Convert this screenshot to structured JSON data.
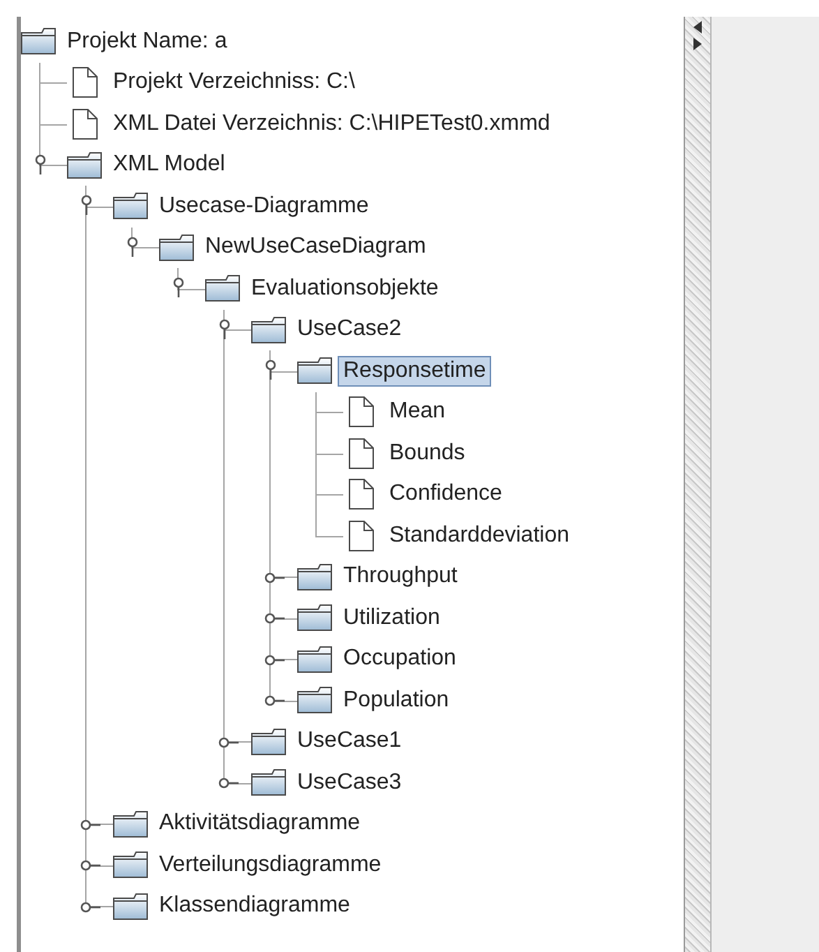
{
  "tree": {
    "label": "Projekt Name: a",
    "kind": "folder",
    "selected": false,
    "children": [
      {
        "label": "Projekt Verzeichniss: C:\\",
        "kind": "file",
        "selected": false
      },
      {
        "label": "XML Datei Verzeichnis: C:\\HIPETest0.xmmd",
        "kind": "file",
        "selected": false
      },
      {
        "label": "XML Model",
        "kind": "folder",
        "expanded": true,
        "selected": false,
        "children": [
          {
            "label": "Usecase-Diagramme",
            "kind": "folder",
            "expanded": true,
            "selected": false,
            "children": [
              {
                "label": "NewUseCaseDiagram",
                "kind": "folder",
                "expanded": true,
                "selected": false,
                "children": [
                  {
                    "label": "Evaluationsobjekte",
                    "kind": "folder",
                    "expanded": true,
                    "selected": false,
                    "children": [
                      {
                        "label": "UseCase2",
                        "kind": "folder",
                        "expanded": true,
                        "selected": false,
                        "children": [
                          {
                            "label": "Responsetime",
                            "kind": "folder",
                            "expanded": true,
                            "selected": true,
                            "children": [
                              {
                                "label": "Mean",
                                "kind": "file",
                                "selected": false
                              },
                              {
                                "label": "Bounds",
                                "kind": "file",
                                "selected": false
                              },
                              {
                                "label": "Confidence",
                                "kind": "file",
                                "selected": false
                              },
                              {
                                "label": "Standarddeviation",
                                "kind": "file",
                                "selected": false
                              }
                            ]
                          },
                          {
                            "label": "Throughput",
                            "kind": "folder",
                            "expanded": false,
                            "selected": false
                          },
                          {
                            "label": "Utilization",
                            "kind": "folder",
                            "expanded": false,
                            "selected": false
                          },
                          {
                            "label": "Occupation",
                            "kind": "folder",
                            "expanded": false,
                            "selected": false
                          },
                          {
                            "label": "Population",
                            "kind": "folder",
                            "expanded": false,
                            "selected": false
                          }
                        ]
                      },
                      {
                        "label": "UseCase1",
                        "kind": "folder",
                        "expanded": false,
                        "selected": false
                      },
                      {
                        "label": "UseCase3",
                        "kind": "folder",
                        "expanded": false,
                        "selected": false
                      }
                    ]
                  }
                ]
              }
            ]
          },
          {
            "label": "Aktivitätsdiagramme",
            "kind": "folder",
            "expanded": false,
            "selected": false
          },
          {
            "label": "Verteilungsdiagramme",
            "kind": "folder",
            "expanded": false,
            "selected": false
          },
          {
            "label": "Klassendiagramme",
            "kind": "folder",
            "expanded": false,
            "selected": false
          }
        ]
      }
    ]
  }
}
